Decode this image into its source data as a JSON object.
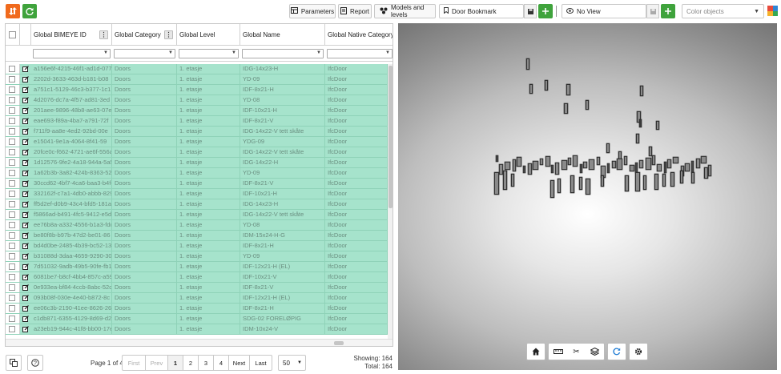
{
  "toolbar": {
    "parameters_label": "Parameters",
    "report_label": "Report",
    "models_label": "Models and levels",
    "bookmark_value": "Door Bookmark",
    "view_value": "No View",
    "color_placeholder": "Color objects",
    "accent_orange": "#f06a1d",
    "accent_green": "#3fa33c"
  },
  "grid": {
    "columns": [
      {
        "key": "id",
        "label": "Global BIMEYE ID"
      },
      {
        "key": "category",
        "label": "Global Category"
      },
      {
        "key": "level",
        "label": "Global Level"
      },
      {
        "key": "name",
        "label": "Global Name"
      },
      {
        "key": "native",
        "label": "Global Native Category"
      }
    ],
    "row_color": "#a6e3cc",
    "rows": [
      {
        "id": "a156e6f-4215-46f1-ad1d-077",
        "category": "Doors",
        "level": "1. etasje",
        "name": "IDG-14x23-H",
        "native": "IfcDoor"
      },
      {
        "id": "2202d-3633-463d-b181-b08",
        "category": "Doors",
        "level": "1. etasje",
        "name": "YD-09",
        "native": "IfcDoor"
      },
      {
        "id": "a751c1-5129-46c3-b377-1c1",
        "category": "Doors",
        "level": "1. etasje",
        "name": "IDF-8x21-H",
        "native": "IfcDoor"
      },
      {
        "id": "4d2076-dc7a-4f57-ad81-3ed",
        "category": "Doors",
        "level": "1. etasje",
        "name": "YD-08",
        "native": "IfcDoor"
      },
      {
        "id": "201aee-9896-48b8-ae63-07e",
        "category": "Doors",
        "level": "1. etasje",
        "name": "IDF-10x21-H",
        "native": "IfcDoor"
      },
      {
        "id": "eae693-f89a-4ba7-a791-72f",
        "category": "Doors",
        "level": "1. etasje",
        "name": "IDF-8x21-V",
        "native": "IfcDoor"
      },
      {
        "id": "f711f9-aa8e-4ed2-92bd-00e",
        "category": "Doors",
        "level": "1. etasje",
        "name": "IDG-14x22-V tett skåte",
        "native": "IfcDoor"
      },
      {
        "id": "e15041-9e1a-4064-8f41-59",
        "category": "Doors",
        "level": "1. etasje",
        "name": "YDG-09",
        "native": "IfcDoor"
      },
      {
        "id": "20fce0c-f662-4721-ae6f-556a",
        "category": "Doors",
        "level": "1. etasje",
        "name": "IDG-14x22-V tett skåte",
        "native": "IfcDoor"
      },
      {
        "id": "1d12576-9fe2-4a18-944a-5a5",
        "category": "Doors",
        "level": "1. etasje",
        "name": "IDG-14x22-H",
        "native": "IfcDoor"
      },
      {
        "id": "1a62b3b-3a82-424b-8363-52",
        "category": "Doors",
        "level": "1. etasje",
        "name": "YD-09",
        "native": "IfcDoor"
      },
      {
        "id": "30ccd62-4bf7-4ca6-baa3-b4fe",
        "category": "Doors",
        "level": "1. etasje",
        "name": "IDF-8x21-V",
        "native": "IfcDoor"
      },
      {
        "id": "332162f-c7a1-4db0-abbb-829",
        "category": "Doors",
        "level": "1. etasje",
        "name": "IDF-10x21-H",
        "native": "IfcDoor"
      },
      {
        "id": "ff5d2ef-d0b9-43c4-bfd5-181a",
        "category": "Doors",
        "level": "1. etasje",
        "name": "IDG-14x23-H",
        "native": "IfcDoor"
      },
      {
        "id": "f5866ad-b491-4fc5-9412-e5d",
        "category": "Doors",
        "level": "1. etasje",
        "name": "IDG-14x22-V tett skåte",
        "native": "IfcDoor"
      },
      {
        "id": "ee76b8a-a332-4556-b1a3-fdc",
        "category": "Doors",
        "level": "1. etasje",
        "name": "YD-08",
        "native": "IfcDoor"
      },
      {
        "id": "be80f8b-b97b-47d2-be01-86",
        "category": "Doors",
        "level": "1. etasje",
        "name": "IDM-15x24-H-G",
        "native": "IfcDoor"
      },
      {
        "id": "bd4d0be-2485-4b39-bc52-13",
        "category": "Doors",
        "level": "1. etasje",
        "name": "IDF-8x21-H",
        "native": "IfcDoor"
      },
      {
        "id": "b31088d-3daa-4659-9290-30",
        "category": "Doors",
        "level": "1. etasje",
        "name": "YD-09",
        "native": "IfcDoor"
      },
      {
        "id": "7d51032-9adb-49b5-90fe-fb1",
        "category": "Doors",
        "level": "1. etasje",
        "name": "IDF-12x21-H (EL)",
        "native": "IfcDoor"
      },
      {
        "id": "6081be7-b8cf-4bb4-857c-a59",
        "category": "Doors",
        "level": "1. etasje",
        "name": "IDF-10x21-V",
        "native": "IfcDoor"
      },
      {
        "id": "0e933ea-bf84-4ccb-8abc-52d",
        "category": "Doors",
        "level": "1. etasje",
        "name": "IDF-8x21-V",
        "native": "IfcDoor"
      },
      {
        "id": "093b08f-030e-4e40-b872-8c",
        "category": "Doors",
        "level": "1. etasje",
        "name": "IDF-12x21-H (EL)",
        "native": "IfcDoor"
      },
      {
        "id": "ee06c3b-2190-41ee-8626-26",
        "category": "Doors",
        "level": "1. etasje",
        "name": "IDF-8x21-H",
        "native": "IfcDoor"
      },
      {
        "id": "c1db871-6355-4129-8d69-d2",
        "category": "Doors",
        "level": "1. etasje",
        "name": "SDG-02 FORELØPIG",
        "native": "IfcDoor"
      },
      {
        "id": "a23eb19-944c-41f8-bb00-17e",
        "category": "Doors",
        "level": "1. etasje",
        "name": "IDM-10x24-V",
        "native": "IfcDoor"
      }
    ]
  },
  "footer": {
    "page_of": "Page 1 of 4",
    "pager": [
      "First",
      "Prev",
      "1",
      "2",
      "3",
      "4",
      "Next",
      "Last"
    ],
    "per_page": "50",
    "showing": "Showing: 164",
    "total": "Total: 164"
  },
  "viewer": {
    "icons": [
      "home-icon",
      "ruler-icon",
      "scissors-icon",
      "layers-icon",
      "refresh-icon",
      "settings-icon"
    ]
  }
}
